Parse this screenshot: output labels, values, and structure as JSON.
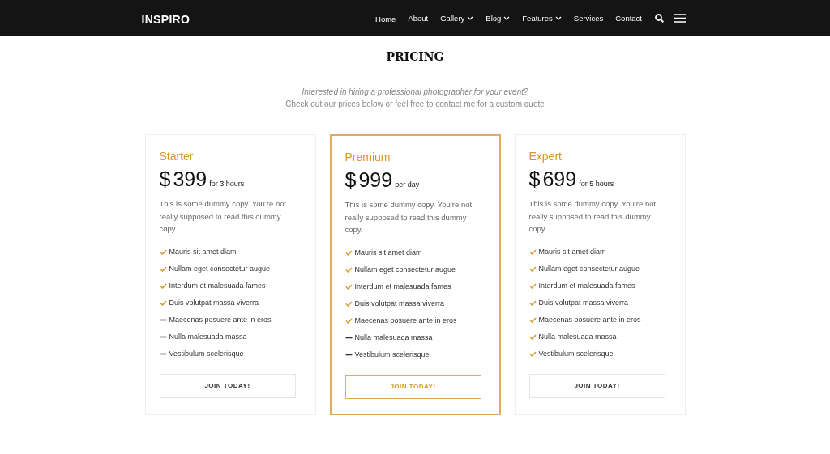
{
  "header": {
    "logo": "INSPIRO",
    "nav": [
      {
        "label": "Home",
        "selected": true,
        "dropdown": false
      },
      {
        "label": "About",
        "selected": false,
        "dropdown": false
      },
      {
        "label": "Gallery",
        "selected": false,
        "dropdown": true
      },
      {
        "label": "Blog",
        "selected": false,
        "dropdown": true
      },
      {
        "label": "Features",
        "selected": false,
        "dropdown": true
      },
      {
        "label": "Services",
        "selected": false,
        "dropdown": false
      },
      {
        "label": "Contact",
        "selected": false,
        "dropdown": false
      }
    ]
  },
  "section": {
    "title": "PRICING",
    "subtitle": "Interested in hiring a professional photographer for your event?",
    "intro": "Check out our prices below or feel free to contact me for a custom quote"
  },
  "plans": [
    {
      "name": "Starter",
      "currency": "$",
      "price": "399",
      "period": "for 3 hours",
      "featured": false,
      "description": "This is some dummy copy. You’re not really supposed to read this dummy copy.",
      "button": "JOIN TODAY!",
      "features": [
        {
          "text": "Mauris sit amet diam",
          "included": true
        },
        {
          "text": "Nullam eget consectetur augue",
          "included": true
        },
        {
          "text": "Interdum et malesuada fames",
          "included": true
        },
        {
          "text": "Duis volutpat massa viverra",
          "included": true
        },
        {
          "text": "Maecenas posuere ante in eros",
          "included": false
        },
        {
          "text": "Nulla malesuada massa",
          "included": false
        },
        {
          "text": "Vestibulum scelerisque",
          "included": false
        }
      ]
    },
    {
      "name": "Premium",
      "currency": "$",
      "price": "999",
      "period": "per day",
      "featured": true,
      "description": "This is some dummy copy. You’re not really supposed to read this dummy copy.",
      "button": "JOIN TODAY!",
      "features": [
        {
          "text": "Mauris sit amet diam",
          "included": true
        },
        {
          "text": "Nullam eget consectetur augue",
          "included": true
        },
        {
          "text": "Interdum et malesuada fames",
          "included": true
        },
        {
          "text": "Duis volutpat massa viverra",
          "included": true
        },
        {
          "text": "Maecenas posuere ante in eros",
          "included": true
        },
        {
          "text": "Nulla malesuada massa",
          "included": false
        },
        {
          "text": "Vestibulum scelerisque",
          "included": false
        }
      ]
    },
    {
      "name": "Expert",
      "currency": "$",
      "price": "699",
      "period": "for 5 hours",
      "featured": false,
      "description": "This is some dummy copy. You’re not really supposed to read this dummy copy.",
      "button": "JOIN TODAY!",
      "features": [
        {
          "text": "Mauris sit amet diam",
          "included": true
        },
        {
          "text": "Nullam eget consectetur augue",
          "included": true
        },
        {
          "text": "Interdum et malesuada fames",
          "included": true
        },
        {
          "text": "Duis volutpat massa viverra",
          "included": true
        },
        {
          "text": "Maecenas posuere ante in eros",
          "included": true
        },
        {
          "text": "Nulla malesuada massa",
          "included": true
        },
        {
          "text": "Vestibulum scelerisque",
          "included": true
        }
      ]
    }
  ]
}
